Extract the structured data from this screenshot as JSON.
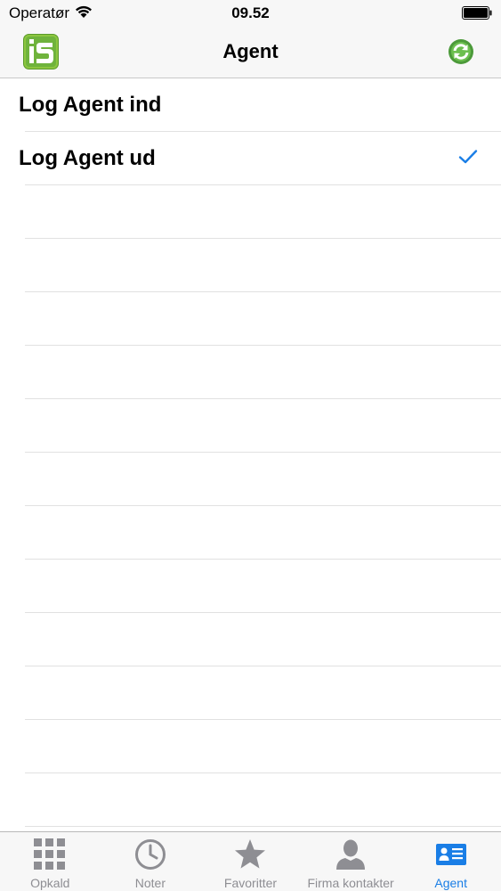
{
  "status_bar": {
    "carrier": "Operatør",
    "time": "09.52"
  },
  "nav": {
    "title": "Agent"
  },
  "list": {
    "items": [
      {
        "label": "Log Agent ind",
        "checked": false
      },
      {
        "label": "Log Agent ud",
        "checked": true
      }
    ]
  },
  "tabs": [
    {
      "label": "Opkald",
      "icon": "keypad-icon",
      "active": false
    },
    {
      "label": "Noter",
      "icon": "clock-icon",
      "active": false
    },
    {
      "label": "Favoritter",
      "icon": "star-icon",
      "active": false
    },
    {
      "label": "Firma kontakter",
      "icon": "person-icon",
      "active": false
    },
    {
      "label": "Agent",
      "icon": "agent-card-icon",
      "active": true
    }
  ],
  "colors": {
    "accent": "#1a7ee6",
    "inactive": "#8e8e93",
    "logo_green": "#6fb33c"
  }
}
